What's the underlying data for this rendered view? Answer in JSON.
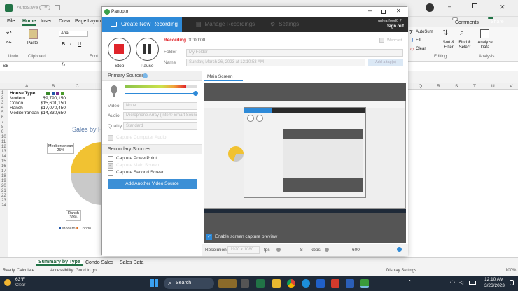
{
  "excel": {
    "autosave": "AutoSave",
    "autosave_state": "Off",
    "menu": [
      "File",
      "Home",
      "Insert",
      "Draw",
      "Page Layout"
    ],
    "comments_label": "Comments",
    "share_label": "Share",
    "font_name": "Arial",
    "ribbon_groups": {
      "undo": "Undo",
      "clipboard": "Clipboard",
      "font_short": "Font",
      "editing": "Editing",
      "analysis": "Analysis"
    },
    "paste_label": "Paste",
    "autosum_label": "AutoSum",
    "fill_label": "Fill",
    "clear_label": "Clear",
    "sort_label": "Sort & Filter",
    "find_label": "Find & Select",
    "analyze_label": "Analyze Data",
    "namebox": "S8",
    "fx": "fx",
    "columns_left": [
      "A",
      "B",
      "C"
    ],
    "columns_right": [
      "Q",
      "R",
      "S",
      "T",
      "U",
      "V"
    ],
    "rows": [
      "1",
      "2",
      "3",
      "4",
      "5",
      "6",
      "7",
      "8",
      "9",
      "10",
      "11",
      "12",
      "13",
      "14",
      "15",
      "16",
      "17",
      "18",
      "19",
      "20",
      "21",
      "22",
      "23",
      "24"
    ],
    "table": {
      "header": "House Type",
      "rows": [
        {
          "type": "Modern",
          "value": "$9,790,150"
        },
        {
          "type": "Condo",
          "value": "$15,601,150"
        },
        {
          "type": "Ranch",
          "value": "$17,070,450"
        },
        {
          "type": "Mediterranean",
          "value": "$14,330,650"
        }
      ]
    },
    "chart_title": "Sales by H",
    "chart_labels": {
      "mediterranean": "Mediterranean",
      "mediterranean_pct": "25%",
      "ranch": "Ranch",
      "ranch_pct": "30%"
    },
    "legend": [
      "Modern",
      "Condo"
    ],
    "sheets": [
      "Summary by Type",
      "Condo Sales",
      "Sales Data"
    ],
    "status_ready": "Ready",
    "status_calculate": "Calculate",
    "status_accessibility": "Accessibility: Good to go",
    "display_settings": "Display Settings",
    "zoom": "100%"
  },
  "panopto": {
    "app_name": "Panopto",
    "tabs": {
      "create": "Create New Recording",
      "manage": "Manage Recordings",
      "settings": "Settings"
    },
    "user": "unlearfood0 ?",
    "sign_out": "Sign out",
    "recording_label": "Recording",
    "recording_time": "00:00:00",
    "webcast": "Webcast",
    "stop_label": "Stop",
    "pause_label": "Pause",
    "folder_label": "Folder",
    "folder_value": "My Folder",
    "name_label": "Name",
    "name_value": "Sunday, March 26, 2023 at 12:10:53 AM",
    "add_tags": "Add a tag(s)",
    "primary_sources": "Primary Sources",
    "video_label": "Video",
    "video_value": "None",
    "audio_label": "Audio",
    "audio_value": "Microphone Array (Intel® Smart Sound)",
    "quality_label": "Quality",
    "quality_value": "Standard",
    "capture_computer_audio": "Capture Computer Audio",
    "secondary_sources": "Secondary Sources",
    "capture_powerpoint": "Capture PowerPoint",
    "capture_main_screen": "Capture Main Screen",
    "capture_second_screen": "Capture Second Screen",
    "add_video_source": "Add Another Video Source",
    "main_screen_tab": "Main Screen",
    "enable_preview": "Enable screen capture preview",
    "resolution_label": "Resolution",
    "resolution_value": "1920 x 1080",
    "fps_label": "fps",
    "fps_value": "8",
    "kbps_label": "kbps",
    "kbps_value": "600",
    "audio_level": 0.85
  },
  "taskbar": {
    "temp": "63°F",
    "weather": "Clear",
    "search": "Search",
    "time": "12:10 AM",
    "date": "3/26/2023"
  },
  "colors": {
    "excel_green": "#217346",
    "panopto_blue": "#2e8ad8",
    "tab_dark": "#2b2b2b",
    "stop_red": "#e0242a"
  }
}
